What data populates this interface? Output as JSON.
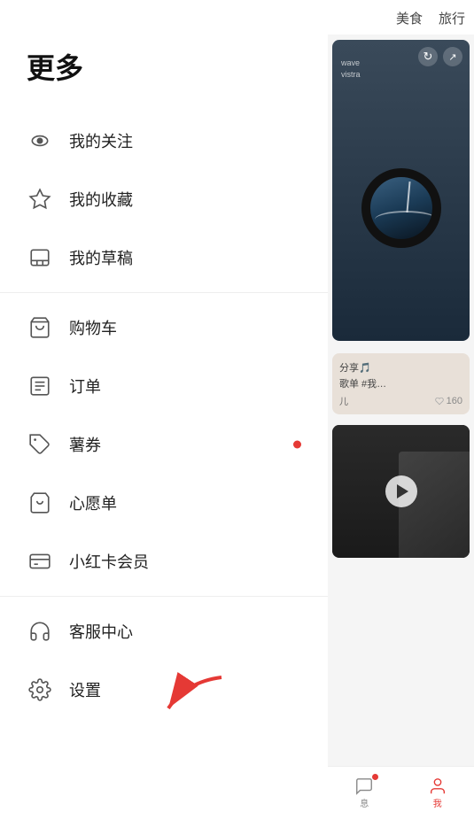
{
  "menu": {
    "title": "更多",
    "items": [
      {
        "id": "my-follows",
        "label": "我的关注",
        "icon": "eye",
        "divider_after": false,
        "has_dot": false
      },
      {
        "id": "my-favorites",
        "label": "我的收藏",
        "icon": "star",
        "divider_after": false,
        "has_dot": false
      },
      {
        "id": "my-drafts",
        "label": "我的草稿",
        "icon": "inbox",
        "divider_after": true,
        "has_dot": false
      },
      {
        "id": "cart",
        "label": "购物车",
        "icon": "cart",
        "divider_after": false,
        "has_dot": false
      },
      {
        "id": "orders",
        "label": "订单",
        "icon": "list",
        "divider_after": false,
        "has_dot": false
      },
      {
        "id": "coupons",
        "label": "薯券",
        "icon": "tag",
        "divider_after": false,
        "has_dot": true
      },
      {
        "id": "wishlist",
        "label": "心愿单",
        "icon": "bag",
        "divider_after": false,
        "has_dot": false
      },
      {
        "id": "membership",
        "label": "小红卡会员",
        "icon": "card",
        "divider_after": true,
        "has_dot": false
      },
      {
        "id": "support",
        "label": "客服中心",
        "icon": "headset",
        "divider_after": false,
        "has_dot": false
      },
      {
        "id": "settings",
        "label": "设置",
        "icon": "gear",
        "divider_after": false,
        "has_dot": false
      }
    ]
  },
  "right_panel": {
    "categories": [
      "美食",
      "旅行"
    ],
    "card_top_info": {
      "line1": "wave",
      "line2": "vistra"
    },
    "card_mid_text": "分享🎵",
    "card_mid_subtext": "歌单 #我…",
    "card_mid_author": "儿",
    "card_mid_likes": "160",
    "bottom_nav": [
      {
        "label": "息",
        "has_dot": true
      },
      {
        "label": "我",
        "has_dot": false
      }
    ]
  }
}
